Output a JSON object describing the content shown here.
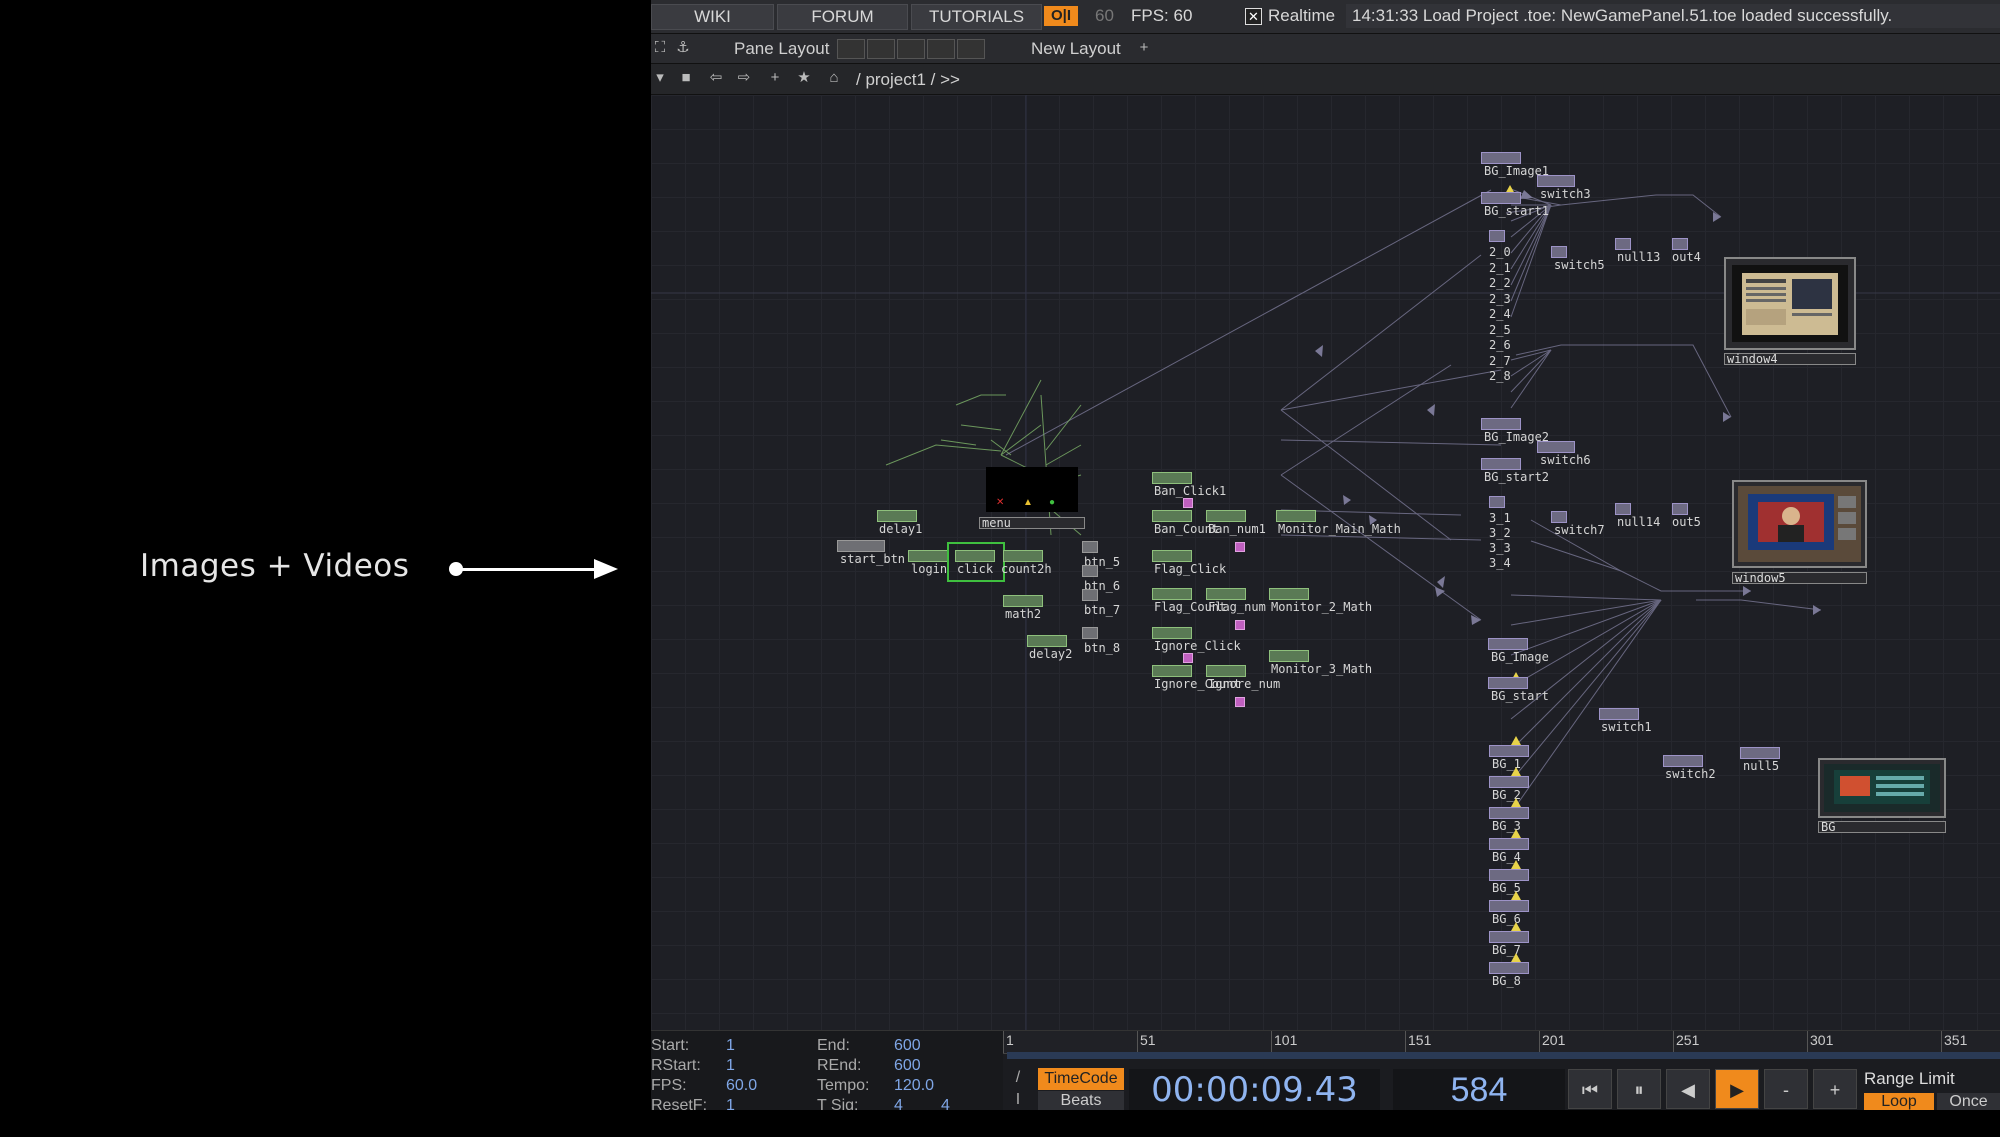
{
  "annotation": {
    "label": "Images + Videos"
  },
  "topbar": {
    "wiki": "WIKI",
    "forum": "FORUM",
    "tutorials": "TUTORIALS",
    "oi": "O|I",
    "fps_dim": "60",
    "fps": "FPS:  60",
    "realtime_check": "✕",
    "realtime": "Realtime",
    "status": "14:31:33 Load Project .toe: NewGamePanel.51.toe loaded successfully."
  },
  "panebar": {
    "pane_layout": "Pane Layout",
    "new_layout": "New Layout",
    "add": "+"
  },
  "pathbar": {
    "path": "/  project1  /  >>"
  },
  "nodes": {
    "bg_image1": "BG_Image1",
    "switch3": "switch3",
    "bg_start1": "BG_start1",
    "switch5": "switch5",
    "null13": "null13",
    "out4": "out4",
    "window4": "window4",
    "bg_image2": "BG_Image2",
    "switch6": "switch6",
    "bg_start2": "BG_start2",
    "switch7": "switch7",
    "null14": "null14",
    "out5": "out5",
    "window5": "window5",
    "bg_image": "BG_Image",
    "bg_start": "BG_start",
    "switch1": "switch1",
    "switch2": "switch2",
    "null5": "null5",
    "bg": "BG",
    "menu": "menu",
    "delay1": "delay1",
    "start_btn": "start_btn",
    "login": "login",
    "click": "click",
    "count2h": "count2h",
    "math2": "math2",
    "delay2": "delay2",
    "btn5": "btn_5",
    "btn6": "btn_6",
    "btn7": "btn_7",
    "btn8": "btn_8",
    "ban_click1": "Ban_Click1",
    "ban_count": "Ban_Count",
    "ban_num1": "Ban_num1",
    "monitor_main_math": "Monitor_Main_Math",
    "flag_click": "Flag_Click",
    "flag_count": "Flag_Count",
    "flag_num": "Flag_num",
    "monitor_2_math": "Monitor_2_Math",
    "ignore_click": "Ignore_Click",
    "ignore_count": "Ignore_Count",
    "ignore_num": "Ignore_num",
    "monitor_3_math": "Monitor_3_Math",
    "stack1": [
      "2_0",
      "2_1",
      "2_2",
      "2_3",
      "2_4",
      "2_5",
      "2_6",
      "2_7",
      "2_8"
    ],
    "stack2": [
      "3_1",
      "3_2",
      "3_3",
      "3_4"
    ],
    "stack3": [
      "BG_1",
      "BG_2",
      "BG_3",
      "BG_4",
      "BG_5",
      "BG_6",
      "BG_7",
      "BG_8"
    ]
  },
  "timeline": {
    "start_k": "Start:",
    "start_v": "1",
    "end_k": "End:",
    "end_v": "600",
    "rstart_k": "RStart:",
    "rstart_v": "1",
    "rend_k": "REnd:",
    "rend_v": "600",
    "fps_k": "FPS:",
    "fps_v": "60.0",
    "tempo_k": "Tempo:",
    "tempo_v": "120.0",
    "resetf_k": "ResetF:",
    "resetf_v": "1",
    "tsig_k": "T Sig:",
    "tsig_v1": "4",
    "tsig_v2": "4",
    "ticks": [
      "1",
      "51",
      "101",
      "151",
      "201",
      "251",
      "301",
      "351"
    ],
    "timecode_btn": "TimeCode",
    "beats_btn": "Beats",
    "timecode": "00:00:09.43",
    "frame": "584",
    "range_limit": "Range Limit",
    "loop": "Loop",
    "once": "Once",
    "minus": "-",
    "plus": "+",
    "slash": "/",
    "bar": "I"
  }
}
